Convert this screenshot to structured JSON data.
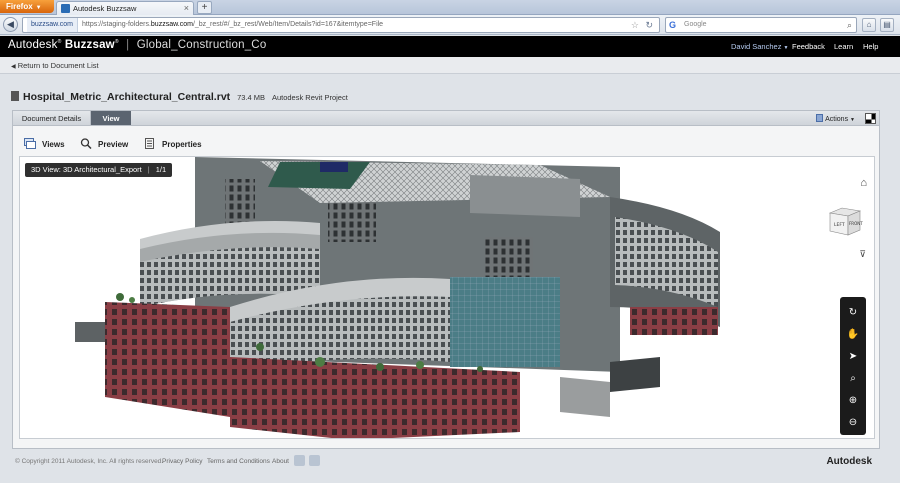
{
  "browser": {
    "menu_button": "Firefox",
    "tab_title": "Autodesk Buzzsaw",
    "new_tab": "+",
    "site_identity": "buzzsaw.com",
    "url_prefix": "https://staging-folders.",
    "url_host": "buzzsaw.com",
    "url_path": "/_bz_rest/#/_bz_rest/Web/Item/Details?id=167&itemtype=File",
    "search_placeholder": "Google"
  },
  "app": {
    "brand_main": "Autodesk",
    "brand_product": "Buzzsaw",
    "org": "Global_Construction_Co",
    "user": "David Sanchez",
    "links": [
      "Feedback",
      "Learn",
      "Help"
    ],
    "return_link": "Return to Document List"
  },
  "document": {
    "name": "Hospital_Metric_Architectural_Central.rvt",
    "size": "73.4 MB",
    "type": "Autodesk Revit Project"
  },
  "tabs": {
    "details": "Document Details",
    "view": "View",
    "actions": "Actions"
  },
  "toolbar": {
    "views": "Views",
    "preview": "Preview",
    "properties": "Properties"
  },
  "viewer": {
    "view_name": "3D View: 3D Architectural_Export",
    "page": "1/1",
    "cube_left": "LEFT",
    "cube_front": "FRONT"
  },
  "footer": {
    "copyright": "© Copyright 2011 Autodesk, Inc. All rights reserved.",
    "privacy": "Privacy Policy",
    "terms": "Terms and Conditions",
    "about": "About",
    "brand": "Autodesk"
  }
}
